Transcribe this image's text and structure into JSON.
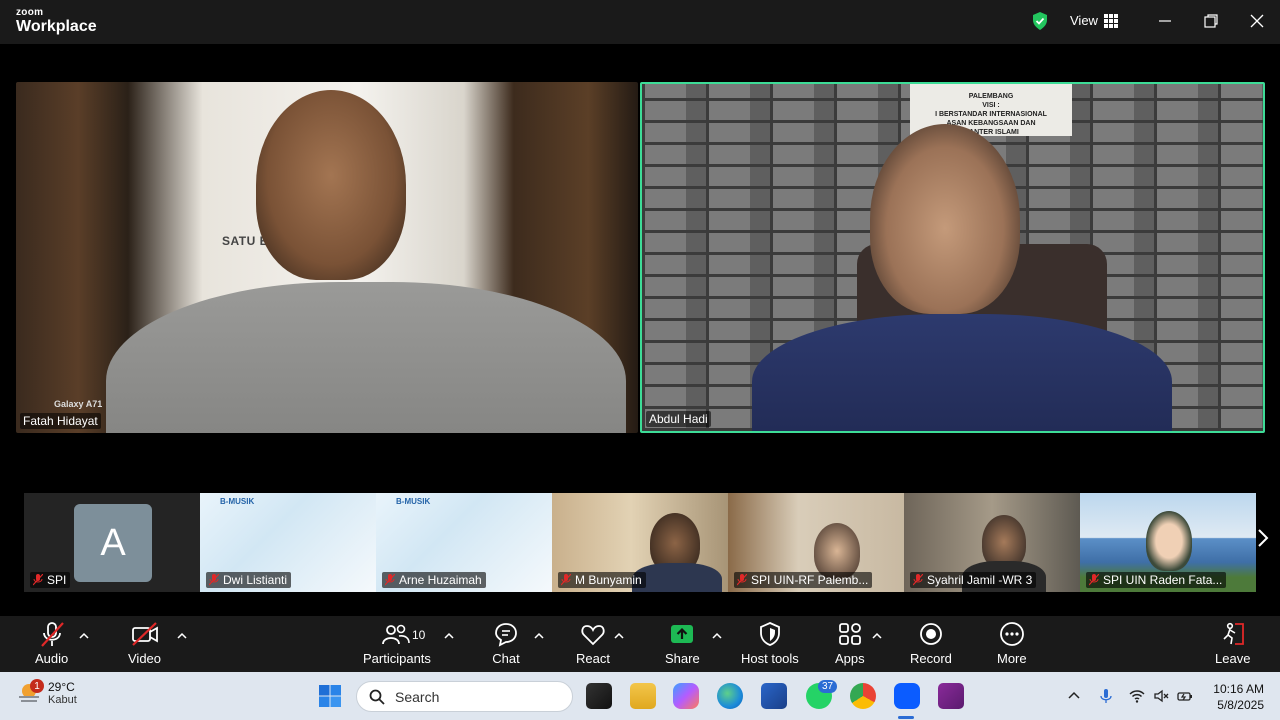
{
  "app": {
    "logo_top": "zoom",
    "logo_bottom": "Workplace",
    "view_label": "View"
  },
  "main_tiles": [
    {
      "name": "Fatah Hidayat",
      "device": "Galaxy A71",
      "background_text": "SATU           ERNAL"
    },
    {
      "name": "Abdul Hadi",
      "sign": "PALEMBANG\nVISI :\nI BERSTANDAR INTERNASIONAL\nASAN KEBANGSAAN DAN\nMANTER ISLAMI"
    }
  ],
  "thumbnails": [
    {
      "name": "SPI",
      "avatar_letter": "A"
    },
    {
      "name": "Dwi Listianti",
      "slide_title": "B-MUSIK"
    },
    {
      "name": "Arne Huzaimah",
      "slide_title": "B-MUSIK"
    },
    {
      "name": "M Bunyamin"
    },
    {
      "name": "SPI UIN-RF Palemb..."
    },
    {
      "name": "Syahril Jamil -WR 3"
    },
    {
      "name": "SPI UIN Raden Fata..."
    }
  ],
  "toolbar": {
    "audio": "Audio",
    "video": "Video",
    "participants": "Participants",
    "participants_count": "10",
    "chat": "Chat",
    "react": "React",
    "share": "Share",
    "host_tools": "Host tools",
    "apps": "Apps",
    "record": "Record",
    "more": "More",
    "leave": "Leave"
  },
  "taskbar": {
    "weather_temp": "29°C",
    "weather_desc": "Kabut",
    "weather_badge": "1",
    "search_placeholder": "Search",
    "whatsapp_badge": "37",
    "time": "10:16 AM",
    "date": "5/8/2025"
  },
  "colors": {
    "active_speaker_border": "#3ddc97",
    "share_green": "#1db954",
    "mute_red": "#e02828"
  }
}
